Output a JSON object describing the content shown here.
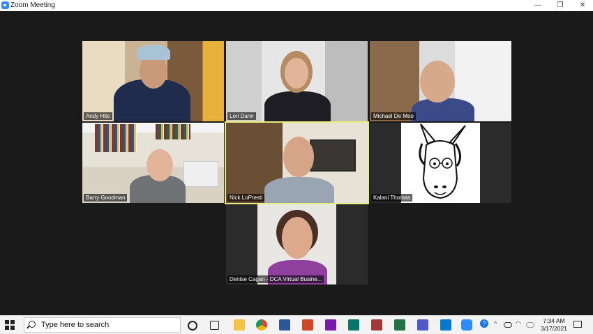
{
  "window": {
    "title": "Zoom Meeting",
    "minimize_glyph": "—",
    "maximize_glyph": "❐",
    "close_glyph": "✕"
  },
  "participants": [
    {
      "name": "Andy Hite",
      "active": false
    },
    {
      "name": "Lori Dann",
      "active": false
    },
    {
      "name": "Michael De Meo",
      "active": false
    },
    {
      "name": "Barry Goodman",
      "active": false
    },
    {
      "name": "Nick LoPresti",
      "active": true
    },
    {
      "name": "Kalani Thomas",
      "active": false
    },
    {
      "name": "Denise Cagan - DCA Virtual Busine...",
      "active": false
    }
  ],
  "taskbar": {
    "search_placeholder": "Type here to search",
    "icons": [
      "cortana-icon",
      "task-view-icon",
      "file-explorer-icon",
      "chrome-icon",
      "word-icon",
      "powerpoint-icon",
      "onenote-icon",
      "publisher-icon",
      "access-icon",
      "excel-icon",
      "teams-icon",
      "outlook-icon",
      "zoom-icon"
    ],
    "tray_help": "?",
    "time": "7:34 AM",
    "date": "3/17/2021"
  },
  "colors": {
    "active_border": "#e7ef7b",
    "zoom_blue": "#2d8cff"
  }
}
